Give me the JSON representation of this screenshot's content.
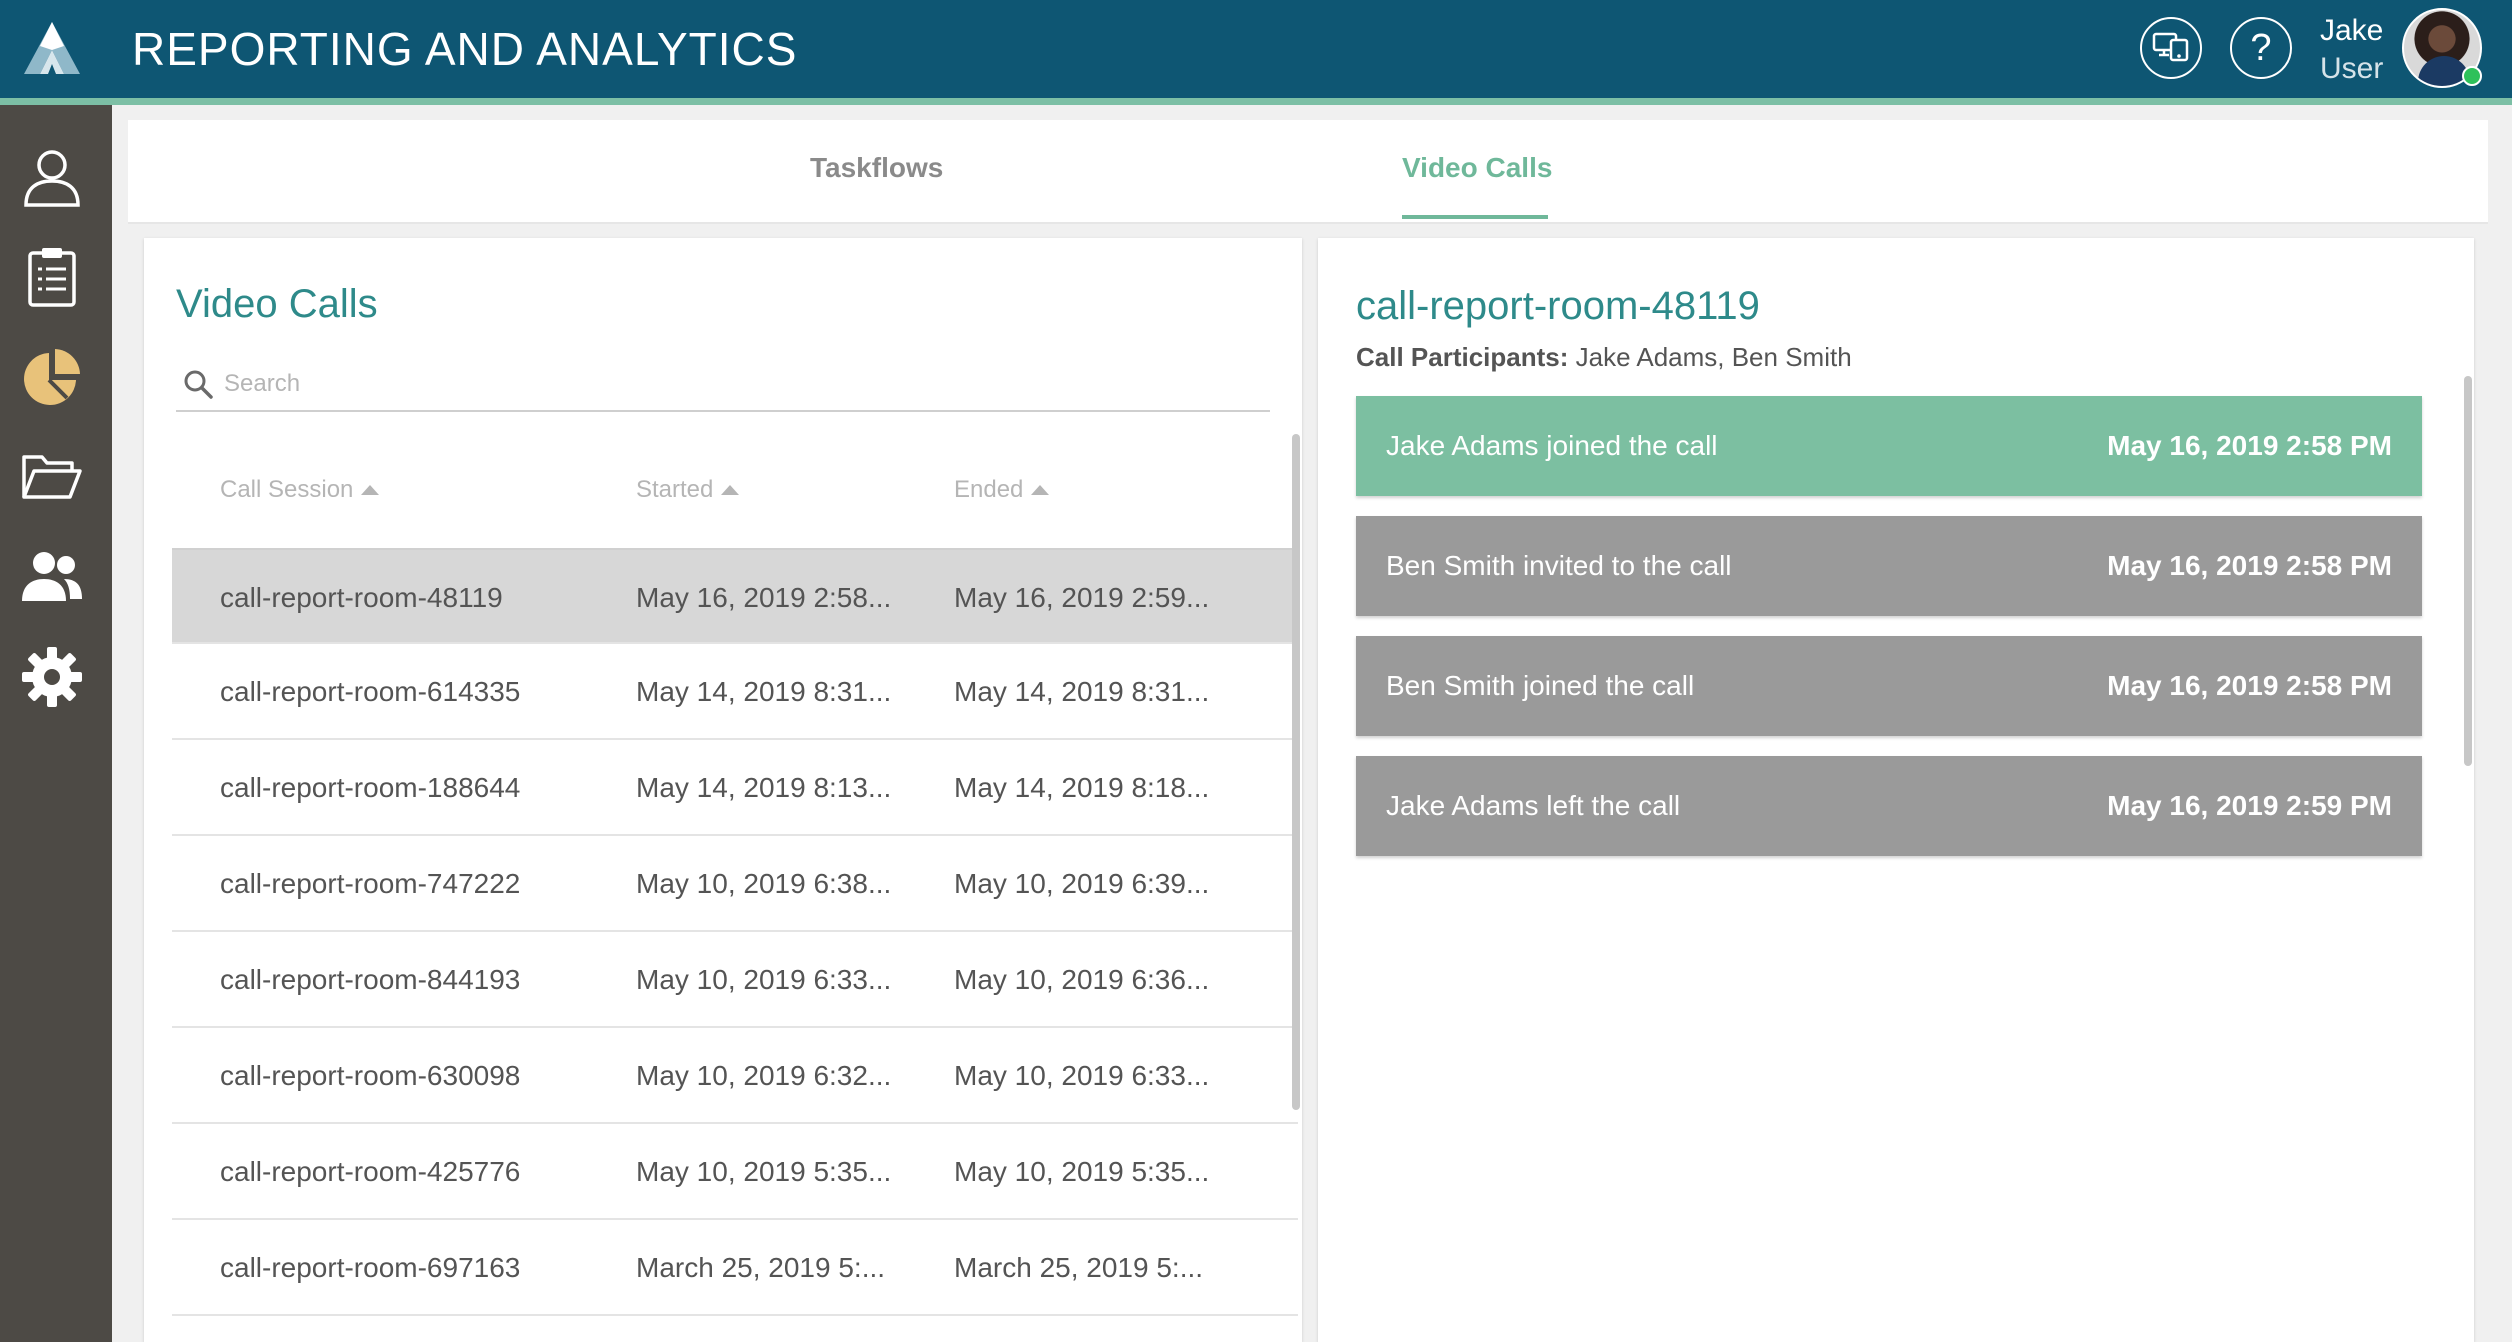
{
  "app": {
    "title": "REPORTING AND ANALYTICS"
  },
  "user": {
    "name": "Jake",
    "role": "User"
  },
  "header": {
    "help_label": "?"
  },
  "sidebar": {
    "items": [
      {
        "icon": "user-icon"
      },
      {
        "icon": "clipboard-icon"
      },
      {
        "icon": "pie-chart-icon"
      },
      {
        "icon": "folder-open-icon"
      },
      {
        "icon": "users-icon"
      },
      {
        "icon": "gear-icon"
      }
    ],
    "active_color": "#e8c27a"
  },
  "tabs": [
    {
      "label": "Taskflows",
      "active": false
    },
    {
      "label": "Video Calls",
      "active": true
    }
  ],
  "list": {
    "title": "Video Calls",
    "search_placeholder": "Search",
    "columns": {
      "session": "Call Session",
      "started": "Started",
      "ended": "Ended"
    },
    "rows": [
      {
        "session": "call-report-room-48119",
        "started": "May 16, 2019 2:58...",
        "ended": "May 16, 2019 2:59...",
        "selected": true
      },
      {
        "session": "call-report-room-614335",
        "started": "May 14, 2019 8:31...",
        "ended": "May 14, 2019 8:31..."
      },
      {
        "session": "call-report-room-188644",
        "started": "May 14, 2019 8:13...",
        "ended": "May 14, 2019 8:18..."
      },
      {
        "session": "call-report-room-747222",
        "started": "May 10, 2019 6:38...",
        "ended": "May 10, 2019 6:39..."
      },
      {
        "session": "call-report-room-844193",
        "started": "May 10, 2019 6:33...",
        "ended": "May 10, 2019 6:36..."
      },
      {
        "session": "call-report-room-630098",
        "started": "May 10, 2019 6:32...",
        "ended": "May 10, 2019 6:33..."
      },
      {
        "session": "call-report-room-425776",
        "started": "May 10, 2019 5:35...",
        "ended": "May 10, 2019 5:35..."
      },
      {
        "session": "call-report-room-697163",
        "started": "March 25, 2019 5:...",
        "ended": "March 25, 2019 5:..."
      }
    ]
  },
  "detail": {
    "title": "call-report-room-48119",
    "participants_label": "Call Participants:",
    "participants": "Jake Adams, Ben Smith",
    "events": [
      {
        "text": "Jake Adams joined the call",
        "time": "May 16, 2019 2:58 PM",
        "active": true
      },
      {
        "text": "Ben Smith invited to the call",
        "time": "May 16, 2019 2:58 PM"
      },
      {
        "text": "Ben Smith joined the call",
        "time": "May 16, 2019 2:58 PM"
      },
      {
        "text": "Jake Adams left the call",
        "time": "May 16, 2019 2:59 PM"
      }
    ]
  },
  "colors": {
    "header": "#0e5673",
    "accent": "#7cbfa5",
    "sidebar": "#4d4a45",
    "title_teal": "#2e8a8a",
    "event_active": "#7cbfa1",
    "event_default": "#9a9a9a"
  }
}
